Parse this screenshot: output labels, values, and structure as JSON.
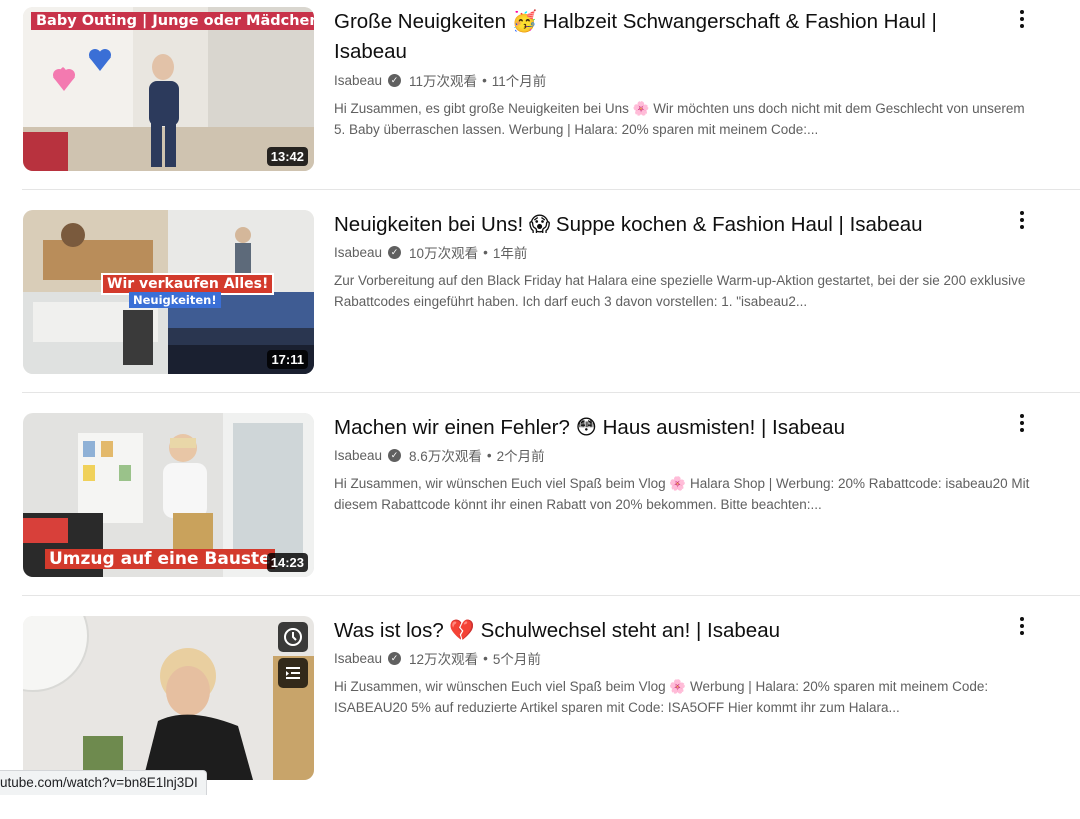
{
  "videos": [
    {
      "title": "Große Neuigkeiten 🥳 Halbzeit Schwangerschaft & Fashion Haul | Isabeau",
      "channel": "Isabeau",
      "views": "11万次观看",
      "age": "11个月前",
      "description": "Hi Zusammen, es gibt große Neuigkeiten bei Uns 🌸 Wir möchten uns doch nicht mit dem Geschlecht von unserem 5. Baby überraschen lassen. Werbung | Halara: 20% sparen mit meinem Code:...",
      "duration": "13:42",
      "thumb_text": "Baby Outing | Junge oder Mädchen?"
    },
    {
      "title": "Neuigkeiten bei Uns! 😱 Suppe kochen & Fashion Haul | Isabeau",
      "channel": "Isabeau",
      "views": "10万次观看",
      "age": "1年前",
      "description": "Zur Vorbereitung auf den Black Friday hat Halara eine spezielle Warm-up-Aktion gestartet, bei der sie 200 exklusive Rabattcodes eingeführt haben. Ich darf euch 3 davon vorstellen: 1. \"isabeau2...",
      "duration": "17:11",
      "thumb_text": "Wir verkaufen Alles!",
      "thumb_text2": "Neuigkeiten!"
    },
    {
      "title": "Machen wir einen Fehler? 😳 Haus ausmisten! | Isabeau",
      "channel": "Isabeau",
      "views": "8.6万次观看",
      "age": "2个月前",
      "description": "Hi Zusammen, wir wünschen Euch viel Spaß beim Vlog 🌸 Halara Shop | Werbung: 20% Rabattcode: isabeau20 Mit diesem Rabattcode könnt ihr einen Rabatt von 20% bekommen. Bitte beachten:...",
      "duration": "14:23",
      "thumb_text": "Umzug auf eine Bauste"
    },
    {
      "title": "Was ist los? 💔 Schulwechsel steht an! | Isabeau",
      "channel": "Isabeau",
      "views": "12万次观看",
      "age": "5个月前",
      "description": "Hi Zusammen, wir wünschen Euch viel Spaß beim Vlog 🌸 Werbung | Halara: 20% sparen mit meinem Code: ISABEAU20 5% auf reduzierte Artikel sparen mit Code: ISA5OFF Hier kommt ihr zum Halara..."
    }
  ],
  "status_url": "utube.com/watch?v=bn8E1lnj3DI",
  "colors": {
    "accent_banner": "#c8334a",
    "banner_red": "#d33a2c",
    "banner_blue": "#3a6fd6"
  },
  "icons": [
    "verified-icon",
    "more-vert-icon",
    "watch-later-icon",
    "add-to-queue-icon"
  ]
}
